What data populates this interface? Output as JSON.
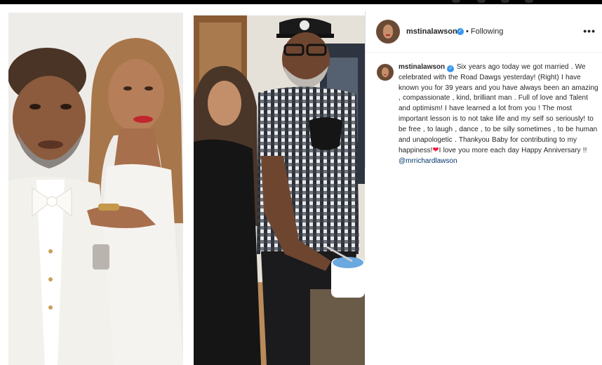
{
  "post": {
    "username": "mstinalawson",
    "following_label": "• Following",
    "more_label": "•••",
    "verified_glyph": "✓",
    "caption_text": "Six years ago today we got married . We celebrated with the Road Dawgs yesterday! (Right) I have known you for 39 years and you have always been an amazing , compassionate , kind, brilliant man . Full of love and Talent and optimism! I have learned a lot from you ! The most important lesson is to not take life and my self so seriously! to be free , to laugh , dance , to be silly sometimes , to be human and unapologetic . Thankyou Baby for contributing to my happiness!",
    "caption_heart": "❤",
    "caption_tail": "I love you more each day Happy Anniversary !!",
    "mention": "@mrrichardlawson"
  },
  "colors": {
    "verified": "#3897f0",
    "mention": "#00376b",
    "heart": "#ed1c3a"
  },
  "icons": [
    "verified-badge-icon",
    "more-options-icon",
    "heart-emoji-icon"
  ]
}
